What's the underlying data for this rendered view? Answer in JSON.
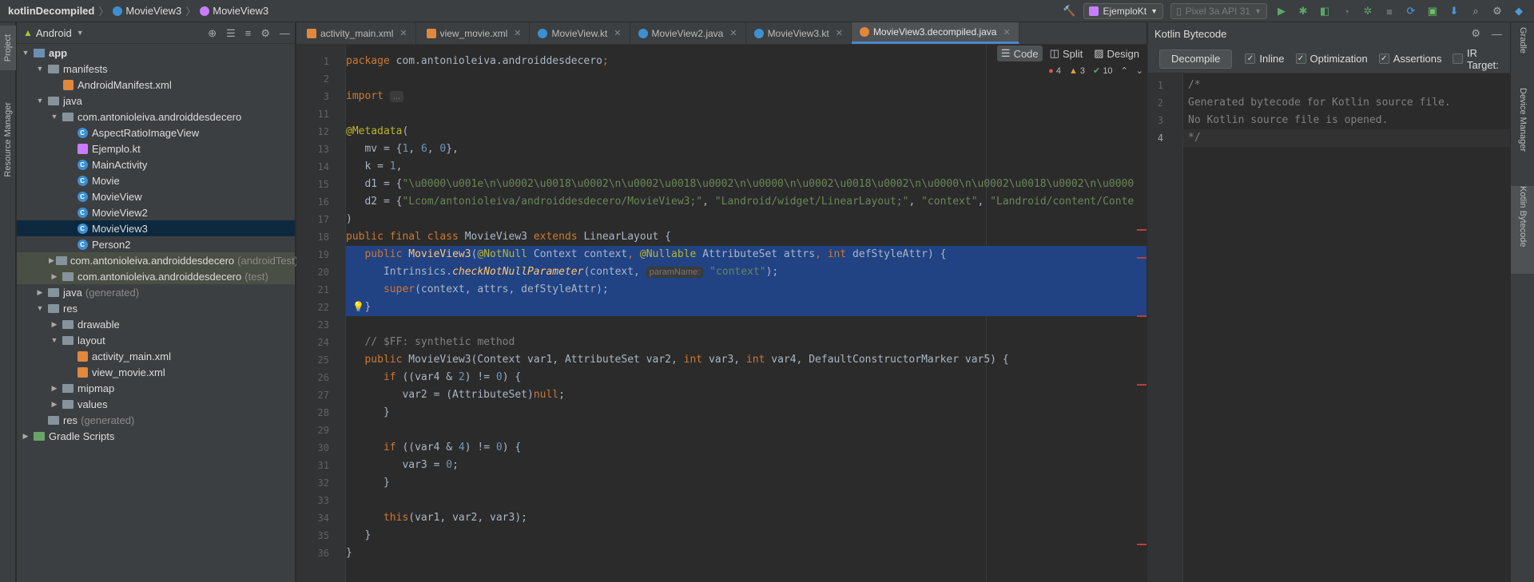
{
  "breadcrumbs": [
    "kotlinDecompiled",
    "MovieView3",
    "MovieView3"
  ],
  "toolbar": {
    "run_config": "EjemploKt",
    "device": "Pixel 3a API 31"
  },
  "left_strip": {
    "project": "Project",
    "resource_manager": "Resource Manager"
  },
  "right_strip": {
    "gradle": "Gradle",
    "device_manager": "Device Manager",
    "kotlin_bytecode": "Kotlin Bytecode"
  },
  "project_panel": {
    "view": "Android",
    "tree": [
      {
        "label": "app",
        "depth": 0,
        "arrow": "open",
        "icon": "folder-blue",
        "bold": true
      },
      {
        "label": "manifests",
        "depth": 1,
        "arrow": "open",
        "icon": "folder"
      },
      {
        "label": "AndroidManifest.xml",
        "depth": 2,
        "arrow": "",
        "icon": "xml"
      },
      {
        "label": "java",
        "depth": 1,
        "arrow": "open",
        "icon": "folder"
      },
      {
        "label": "com.antonioleiva.androiddesdecero",
        "depth": 2,
        "arrow": "open",
        "icon": "folder"
      },
      {
        "label": "AspectRatioImageView",
        "depth": 3,
        "arrow": "",
        "icon": "class"
      },
      {
        "label": "Ejemplo.kt",
        "depth": 3,
        "arrow": "",
        "icon": "kotlin"
      },
      {
        "label": "MainActivity",
        "depth": 3,
        "arrow": "",
        "icon": "class"
      },
      {
        "label": "Movie",
        "depth": 3,
        "arrow": "",
        "icon": "class"
      },
      {
        "label": "MovieView",
        "depth": 3,
        "arrow": "",
        "icon": "class"
      },
      {
        "label": "MovieView2",
        "depth": 3,
        "arrow": "",
        "icon": "class"
      },
      {
        "label": "MovieView3",
        "depth": 3,
        "arrow": "",
        "icon": "class",
        "selected": true
      },
      {
        "label": "Person2",
        "depth": 3,
        "arrow": "",
        "icon": "class"
      },
      {
        "label": "com.antonioleiva.androiddesdecero",
        "suffix": "(androidTest)",
        "depth": 2,
        "arrow": "closed",
        "icon": "folder",
        "highlight": true
      },
      {
        "label": "com.antonioleiva.androiddesdecero",
        "suffix": "(test)",
        "depth": 2,
        "arrow": "closed",
        "icon": "folder",
        "highlight": true
      },
      {
        "label": "java",
        "suffix": "(generated)",
        "depth": 1,
        "arrow": "closed",
        "icon": "folder"
      },
      {
        "label": "res",
        "depth": 1,
        "arrow": "open",
        "icon": "folder"
      },
      {
        "label": "drawable",
        "depth": 2,
        "arrow": "closed",
        "icon": "folder"
      },
      {
        "label": "layout",
        "depth": 2,
        "arrow": "open",
        "icon": "folder"
      },
      {
        "label": "activity_main.xml",
        "depth": 3,
        "arrow": "",
        "icon": "xml"
      },
      {
        "label": "view_movie.xml",
        "depth": 3,
        "arrow": "",
        "icon": "xml"
      },
      {
        "label": "mipmap",
        "depth": 2,
        "arrow": "closed",
        "icon": "folder"
      },
      {
        "label": "values",
        "depth": 2,
        "arrow": "closed",
        "icon": "folder"
      },
      {
        "label": "res",
        "suffix": "(generated)",
        "depth": 1,
        "arrow": "",
        "icon": "folder"
      },
      {
        "label": "Gradle Scripts",
        "depth": 0,
        "arrow": "closed",
        "icon": "gradle"
      }
    ]
  },
  "tabs": [
    {
      "label": "activity_main.xml",
      "icon": "x"
    },
    {
      "label": "view_movie.xml",
      "icon": "x"
    },
    {
      "label": "MovieView.kt",
      "icon": "c"
    },
    {
      "label": "MovieView2.java",
      "icon": "c"
    },
    {
      "label": "MovieView3.kt",
      "icon": "c"
    },
    {
      "label": "MovieView3.decompiled.java",
      "icon": "j",
      "active": true
    }
  ],
  "editor_modes": {
    "code": "Code",
    "split": "Split",
    "design": "Design"
  },
  "inspections": {
    "errors": "4",
    "warnings": "3",
    "ok": "10"
  },
  "code_lines": [
    {
      "n": "1",
      "parts": [
        [
          "kw",
          "package "
        ],
        [
          "",
          "com.antonioleiva.androiddesdecero"
        ],
        [
          "kw",
          ";"
        ]
      ]
    },
    {
      "n": "2",
      "parts": []
    },
    {
      "n": "3",
      "parts": [
        [
          "kw",
          "import "
        ],
        [
          "hint",
          "..."
        ]
      ]
    },
    {
      "n": "11",
      "parts": []
    },
    {
      "n": "12",
      "parts": [
        [
          "ann",
          "@Metadata"
        ],
        [
          "",
          "("
        ]
      ]
    },
    {
      "n": "13",
      "parts": [
        [
          "",
          "   mv = {"
        ],
        [
          "num",
          "1"
        ],
        [
          "",
          ", "
        ],
        [
          "num",
          "6"
        ],
        [
          "",
          ", "
        ],
        [
          "num",
          "0"
        ],
        [
          "",
          "},"
        ]
      ]
    },
    {
      "n": "14",
      "parts": [
        [
          "",
          "   k = "
        ],
        [
          "num",
          "1"
        ],
        [
          "",
          ","
        ]
      ]
    },
    {
      "n": "15",
      "parts": [
        [
          "",
          "   d1 = {"
        ],
        [
          "str",
          "\"\\u0000\\u001e\\n\\u0002\\u0018\\u0002\\n\\u0002\\u0018\\u0002\\n\\u0000\\n\\u0002\\u0018\\u0002\\n\\u0000\\n\\u0002\\u0018\\u0002\\n\\u0000"
        ]
      ]
    },
    {
      "n": "16",
      "parts": [
        [
          "",
          "   d2 = {"
        ],
        [
          "str",
          "\"Lcom/antonioleiva/androiddesdecero/MovieView3;\""
        ],
        [
          "",
          ", "
        ],
        [
          "str",
          "\"Landroid/widget/LinearLayout;\""
        ],
        [
          "",
          ", "
        ],
        [
          "str",
          "\"context\""
        ],
        [
          "",
          ", "
        ],
        [
          "str",
          "\"Landroid/content/Conte"
        ]
      ]
    },
    {
      "n": "17",
      "parts": [
        [
          "",
          ")"
        ]
      ]
    },
    {
      "n": "18",
      "parts": [
        [
          "kw",
          "public final class "
        ],
        [
          "",
          "MovieView3 "
        ],
        [
          "kw",
          "extends "
        ],
        [
          "",
          "LinearLayout {"
        ]
      ]
    },
    {
      "n": "19",
      "parts": [
        [
          "",
          "   "
        ],
        [
          "kw",
          "public "
        ],
        [
          "fn",
          "MovieView3"
        ],
        [
          "",
          "("
        ],
        [
          "ann",
          "@NotNull "
        ],
        [
          "",
          "Context context"
        ],
        [
          "kw",
          ", "
        ],
        [
          "ann",
          "@Nullable "
        ],
        [
          "",
          "AttributeSet attrs"
        ],
        [
          "kw",
          ", "
        ],
        [
          "kw",
          "int "
        ],
        [
          "",
          "defStyleAttr) {"
        ]
      ],
      "sel": true
    },
    {
      "n": "20",
      "parts": [
        [
          "",
          "      Intrinsics."
        ],
        [
          "fnit",
          "checkNotNullParameter"
        ],
        [
          "",
          "(context, "
        ],
        [
          "hint",
          "paramName:"
        ],
        [
          "str",
          " \"context\""
        ],
        [
          "",
          ");"
        ]
      ],
      "sel": true
    },
    {
      "n": "21",
      "parts": [
        [
          "",
          "      "
        ],
        [
          "kw",
          "super"
        ],
        [
          "",
          "(context, attrs, defStyleAttr);"
        ]
      ],
      "sel": true
    },
    {
      "n": "22",
      "parts": [
        [
          "",
          "   }"
        ]
      ],
      "sel": true
    },
    {
      "n": "23",
      "parts": []
    },
    {
      "n": "24",
      "parts": [
        [
          "cmt",
          "   // $FF: synthetic method"
        ]
      ]
    },
    {
      "n": "25",
      "parts": [
        [
          "",
          "   "
        ],
        [
          "kw",
          "public "
        ],
        [
          "",
          "MovieView3(Context var1, AttributeSet var2, "
        ],
        [
          "kw",
          "int "
        ],
        [
          "",
          "var3, "
        ],
        [
          "kw",
          "int "
        ],
        [
          "",
          "var4, DefaultConstructorMarker var5) {"
        ]
      ]
    },
    {
      "n": "26",
      "parts": [
        [
          "",
          "      "
        ],
        [
          "kw",
          "if "
        ],
        [
          "",
          "((var4 & "
        ],
        [
          "num",
          "2"
        ],
        [
          "",
          ") != "
        ],
        [
          "num",
          "0"
        ],
        [
          "",
          ") {"
        ]
      ]
    },
    {
      "n": "27",
      "parts": [
        [
          "",
          "         var2 = (AttributeSet)"
        ],
        [
          "kw",
          "null"
        ],
        [
          "",
          ";"
        ]
      ]
    },
    {
      "n": "28",
      "parts": [
        [
          "",
          "      }"
        ]
      ]
    },
    {
      "n": "29",
      "parts": []
    },
    {
      "n": "30",
      "parts": [
        [
          "",
          "      "
        ],
        [
          "kw",
          "if "
        ],
        [
          "",
          "((var4 & "
        ],
        [
          "num",
          "4"
        ],
        [
          "",
          ") != "
        ],
        [
          "num",
          "0"
        ],
        [
          "",
          ") {"
        ]
      ]
    },
    {
      "n": "31",
      "parts": [
        [
          "",
          "         var3 = "
        ],
        [
          "num",
          "0"
        ],
        [
          "",
          ";"
        ]
      ]
    },
    {
      "n": "32",
      "parts": [
        [
          "",
          "      }"
        ]
      ]
    },
    {
      "n": "33",
      "parts": []
    },
    {
      "n": "34",
      "parts": [
        [
          "",
          "      "
        ],
        [
          "kw",
          "this"
        ],
        [
          "",
          "(var1, var2, var3);"
        ]
      ]
    },
    {
      "n": "35",
      "parts": [
        [
          "",
          "   }"
        ]
      ]
    },
    {
      "n": "36",
      "parts": [
        [
          "",
          "}"
        ]
      ]
    }
  ],
  "bytecode_panel": {
    "title": "Kotlin Bytecode",
    "decompile": "Decompile",
    "options": [
      {
        "label": "Inline",
        "checked": true
      },
      {
        "label": "Optimization",
        "checked": true
      },
      {
        "label": "Assertions",
        "checked": true
      },
      {
        "label": "IR Target:",
        "checked": false
      }
    ],
    "lines": [
      {
        "n": "1",
        "text": "/*"
      },
      {
        "n": "2",
        "text": "Generated bytecode for Kotlin source file."
      },
      {
        "n": "3",
        "text": "No Kotlin source file is opened."
      },
      {
        "n": "4",
        "text": "*/"
      }
    ]
  }
}
